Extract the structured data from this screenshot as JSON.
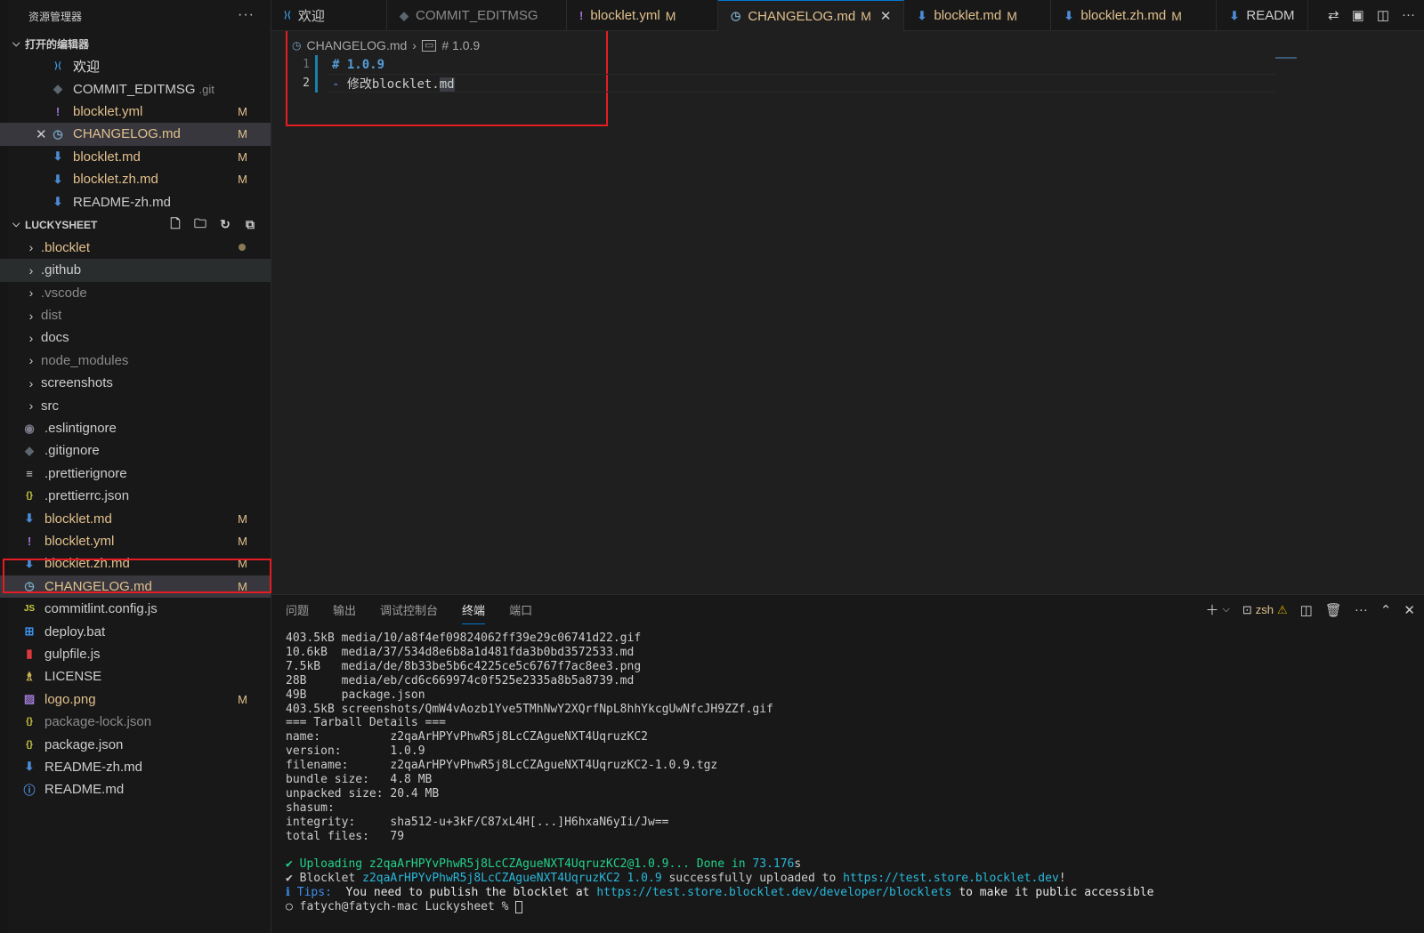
{
  "sidebar": {
    "title": "资源管理器",
    "more": "···",
    "open_editors": {
      "title": "打开的编辑器",
      "items": [
        {
          "icon": "vscode-icon",
          "label": "欢迎",
          "suffix": "",
          "badge": "",
          "selected": false
        },
        {
          "icon": "git-icon",
          "label": "COMMIT_EDITMSG",
          "suffix": ".git",
          "badge": "",
          "selected": false
        },
        {
          "icon": "yaml-icon",
          "label": "blocklet.yml",
          "suffix": "",
          "badge": "M",
          "selected": false
        },
        {
          "icon": "changelog-icon",
          "label": "CHANGELOG.md",
          "suffix": "",
          "badge": "M",
          "selected": true
        },
        {
          "icon": "markdown-icon",
          "label": "blocklet.md",
          "suffix": "",
          "badge": "M",
          "selected": false
        },
        {
          "icon": "markdown-icon",
          "label": "blocklet.zh.md",
          "suffix": "",
          "badge": "M",
          "selected": false
        },
        {
          "icon": "markdown-icon",
          "label": "README-zh.md",
          "suffix": "",
          "badge": "",
          "selected": false
        }
      ]
    },
    "project": {
      "title": "LUCKYSHEET",
      "folders": [
        ".blocklet",
        ".github",
        ".vscode",
        "dist",
        "docs",
        "node_modules",
        "screenshots",
        "src"
      ],
      "files": [
        {
          "icon": "eslint-icon",
          "label": ".eslintignore",
          "badge": ""
        },
        {
          "icon": "git-icon",
          "label": ".gitignore",
          "badge": ""
        },
        {
          "icon": "lines-icon",
          "label": ".prettierignore",
          "badge": ""
        },
        {
          "icon": "json-icon",
          "label": ".prettierrc.json",
          "badge": ""
        },
        {
          "icon": "markdown-icon",
          "label": "blocklet.md",
          "badge": "M"
        },
        {
          "icon": "yaml-icon",
          "label": "blocklet.yml",
          "badge": "M"
        },
        {
          "icon": "markdown-icon",
          "label": "blocklet.zh.md",
          "badge": "M"
        },
        {
          "icon": "changelog-icon",
          "label": "CHANGELOG.md",
          "badge": "M"
        },
        {
          "icon": "js-icon",
          "label": "commitlint.config.js",
          "badge": ""
        },
        {
          "icon": "windows-icon",
          "label": "deploy.bat",
          "badge": ""
        },
        {
          "icon": "gulp-icon",
          "label": "gulpfile.js",
          "badge": ""
        },
        {
          "icon": "license-icon",
          "label": "LICENSE",
          "badge": ""
        },
        {
          "icon": "image-icon",
          "label": "logo.png",
          "badge": "M"
        },
        {
          "icon": "json-icon",
          "label": "package-lock.json",
          "badge": ""
        },
        {
          "icon": "json-icon",
          "label": "package.json",
          "badge": ""
        },
        {
          "icon": "markdown-icon",
          "label": "README-zh.md",
          "badge": ""
        },
        {
          "icon": "info-icon",
          "label": "README.md",
          "badge": ""
        }
      ]
    }
  },
  "tabs": [
    {
      "icon": "vscode-icon",
      "label": "欢迎",
      "badge": ""
    },
    {
      "icon": "git-icon",
      "label": "COMMIT_EDITMSG",
      "badge": ""
    },
    {
      "icon": "yaml-icon",
      "label": "blocklet.yml",
      "badge": "M"
    },
    {
      "icon": "changelog-icon",
      "label": "CHANGELOG.md",
      "badge": "M",
      "active": true
    },
    {
      "icon": "markdown-icon",
      "label": "blocklet.md",
      "badge": "M"
    },
    {
      "icon": "markdown-icon",
      "label": "blocklet.zh.md",
      "badge": "M"
    },
    {
      "icon": "markdown-icon",
      "label": "READM",
      "badge": ""
    }
  ],
  "breadcrumb": {
    "file": "CHANGELOG.md",
    "symbol": "# 1.0.9"
  },
  "editor": {
    "lines": [
      {
        "num": "1",
        "heading": "# 1.0.9"
      },
      {
        "num": "2",
        "dash": "-",
        "text": " 修改blocklet.",
        "selected": "md"
      }
    ]
  },
  "panel": {
    "tabs": [
      "问题",
      "输出",
      "调试控制台",
      "终端",
      "端口"
    ],
    "active_tab": "终端",
    "shell": "zsh",
    "terminal": {
      "lines": [
        "403.5kB media/10/a8f4ef09824062ff39e29c06741d22.gif",
        "10.6kB  media/37/534d8e6b8a1d481fda3b0bd3572533.md",
        "7.5kB   media/de/8b33be5b6c4225ce5c6767f7ac8ee3.png",
        "28B     media/eb/cd6c669974c0f525e2335a8b5a8739.md",
        "49B     package.json",
        "403.5kB screenshots/QmW4vAozb1Yve5TMhNwY2XQrfNpL8hhYkcgUwNfcJH9ZZf.gif",
        "=== Tarball Details ===",
        "name:          z2qaArHPYvPhwR5j8LcCZAgueNXT4UqruzKC2",
        "version:       1.0.9",
        "filename:      z2qaArHPYvPhwR5j8LcCZAgueNXT4UqruzKC2-1.0.9.tgz",
        "bundle size:   4.8 MB",
        "unpacked size: 20.4 MB",
        "shasum:",
        "integrity:     sha512-u+3kF/C87xL4H[...]H6hxaN6yIi/Jw==",
        "total files:   79",
        ""
      ],
      "upload_prefix": "✔ Uploading z2qaArHPYvPhwR5j8LcCZAgueNXT4UqruzKC2@1.0.9... Done in ",
      "upload_time": "73.176",
      "upload_suffix": "s",
      "blocklet_prefix": "✔ Blocklet ",
      "blocklet_id": "z2qaArHPYvPhwR5j8LcCZAgueNXT4UqruzKC2 1.0.9",
      "blocklet_mid": " successfully uploaded to ",
      "blocklet_url": "https://test.store.blocklet.dev",
      "blocklet_end": "!",
      "tips_label": "ℹ Tips:",
      "tips_text": "  You need to publish the blocklet at ",
      "tips_url": "https://test.store.blocklet.dev/developer/blocklets",
      "tips_end": " to make it public accessible",
      "prompt": "○ fatych@fatych-mac Luckysheet % "
    }
  },
  "colors": {
    "accent": "#0078d4",
    "modified": "#e2c08d",
    "highlight_box": "#e51c23"
  }
}
